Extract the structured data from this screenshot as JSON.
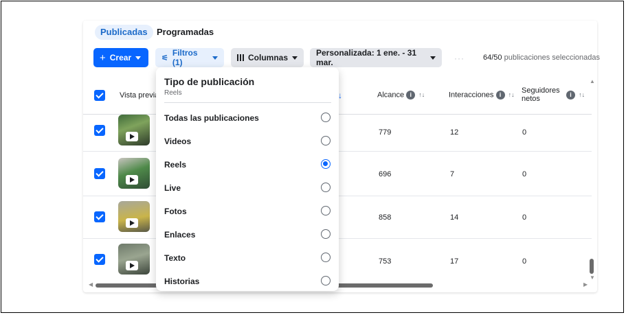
{
  "tabs": [
    {
      "label": "Publicadas",
      "active": true
    },
    {
      "label": "Programadas",
      "active": false
    }
  ],
  "toolbar": {
    "crear_label": "Crear",
    "filtros_label": "Filtros (1)",
    "columnas_label": "Columnas",
    "fecha_label": "Personalizada: 1 ene. - 31 mar.",
    "more_label": "···",
    "selected_count": "64/50",
    "selected_text": "publicaciones seleccionadas"
  },
  "table": {
    "headers": {
      "preview": "Vista previa",
      "alcance": "Alcance",
      "interacciones": "Interacciones",
      "seguidores": "Seguidores netos",
      "sort_arrow": "↓",
      "sort_icon": "↑↓"
    },
    "rows": [
      {
        "alcance": "779",
        "interacciones": "12",
        "seguidores": "0",
        "checked": true
      },
      {
        "alcance": "696",
        "interacciones": "7",
        "seguidores": "0",
        "checked": true
      },
      {
        "alcance": "858",
        "interacciones": "14",
        "seguidores": "0",
        "checked": true
      },
      {
        "alcance": "753",
        "interacciones": "17",
        "seguidores": "0",
        "checked": true
      }
    ]
  },
  "filter_menu": {
    "title": "Tipo de publicación",
    "current": "Reels",
    "options": [
      {
        "label": "Todas las publicaciones",
        "selected": false
      },
      {
        "label": "Videos",
        "selected": false
      },
      {
        "label": "Reels",
        "selected": true
      },
      {
        "label": "Live",
        "selected": false
      },
      {
        "label": "Fotos",
        "selected": false
      },
      {
        "label": "Enlaces",
        "selected": false
      },
      {
        "label": "Texto",
        "selected": false
      },
      {
        "label": "Historias",
        "selected": false
      }
    ]
  },
  "colors": {
    "accent": "#0866ff",
    "tab_bg": "#e7f0fd",
    "tab_text": "#1b6ac9",
    "neutral_button": "#e4e6eb"
  },
  "icons": {
    "plus": "plus-icon",
    "filter": "filter-icon",
    "columns": "columns-icon",
    "info": "info-icon",
    "reel": "reel-play-icon"
  }
}
